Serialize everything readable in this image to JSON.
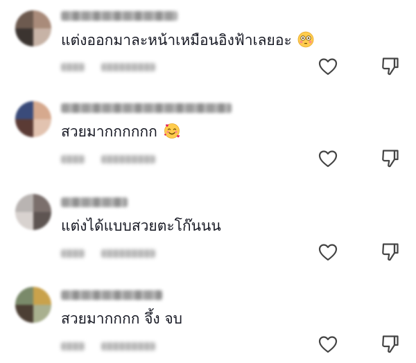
{
  "comments": [
    {
      "text": "แต่งออกมาละหน้าเหมือนอิงฟ้าเลยอะ",
      "emoji": "flushed-face-emoji",
      "avatar_colors": [
        "#6d5a4f",
        "#a98b7a",
        "#3b3430",
        "#c7b3a6"
      ]
    },
    {
      "text": "สวยมากกกกกก",
      "emoji": "smiling-face-with-hearts-emoji",
      "avatar_colors": [
        "#3a4b7a",
        "#d6a98e",
        "#5b3b35",
        "#e2c3b0"
      ]
    },
    {
      "text": "แต่งได้แบบสวยตะโก๊นนน",
      "emoji": "",
      "avatar_colors": [
        "#b9b4b2",
        "#7b6f6c",
        "#d8d2cf",
        "#5e5552"
      ]
    },
    {
      "text": "สวยมากกกก จึ้ง จบ",
      "emoji": "",
      "avatar_colors": [
        "#7a8a6a",
        "#c9a24c",
        "#4c3f34",
        "#a9b08f"
      ]
    }
  ],
  "icons": {
    "like": "heart-outline-icon",
    "dislike": "thumbs-down-outline-icon"
  }
}
